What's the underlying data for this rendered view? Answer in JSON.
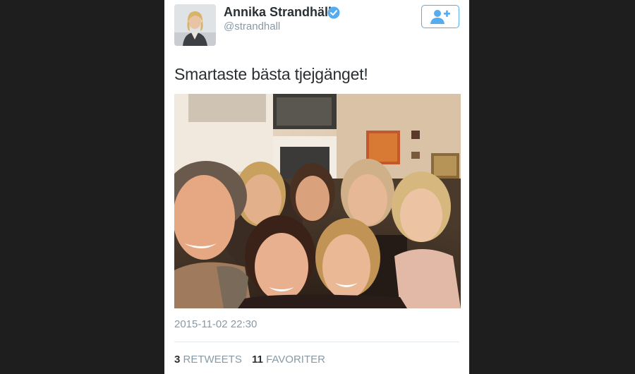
{
  "tweet": {
    "author": {
      "display_name": "Annika Strandhäll",
      "handle": "@strandhall",
      "verified": true
    },
    "follow_button_icon": "add-user-icon",
    "text": "Smartaste bästa tjejgänget!",
    "timestamp": "2015-11-02 22:30",
    "stats": {
      "retweets_count": "3",
      "retweets_label": "RETWEETS",
      "favorites_count": "11",
      "favorites_label": "FAVORITER"
    }
  },
  "colors": {
    "background": "#1e1e1e",
    "card": "#ffffff",
    "accent": "#55acee",
    "text_primary": "#292f33",
    "text_secondary": "#8899a6"
  }
}
